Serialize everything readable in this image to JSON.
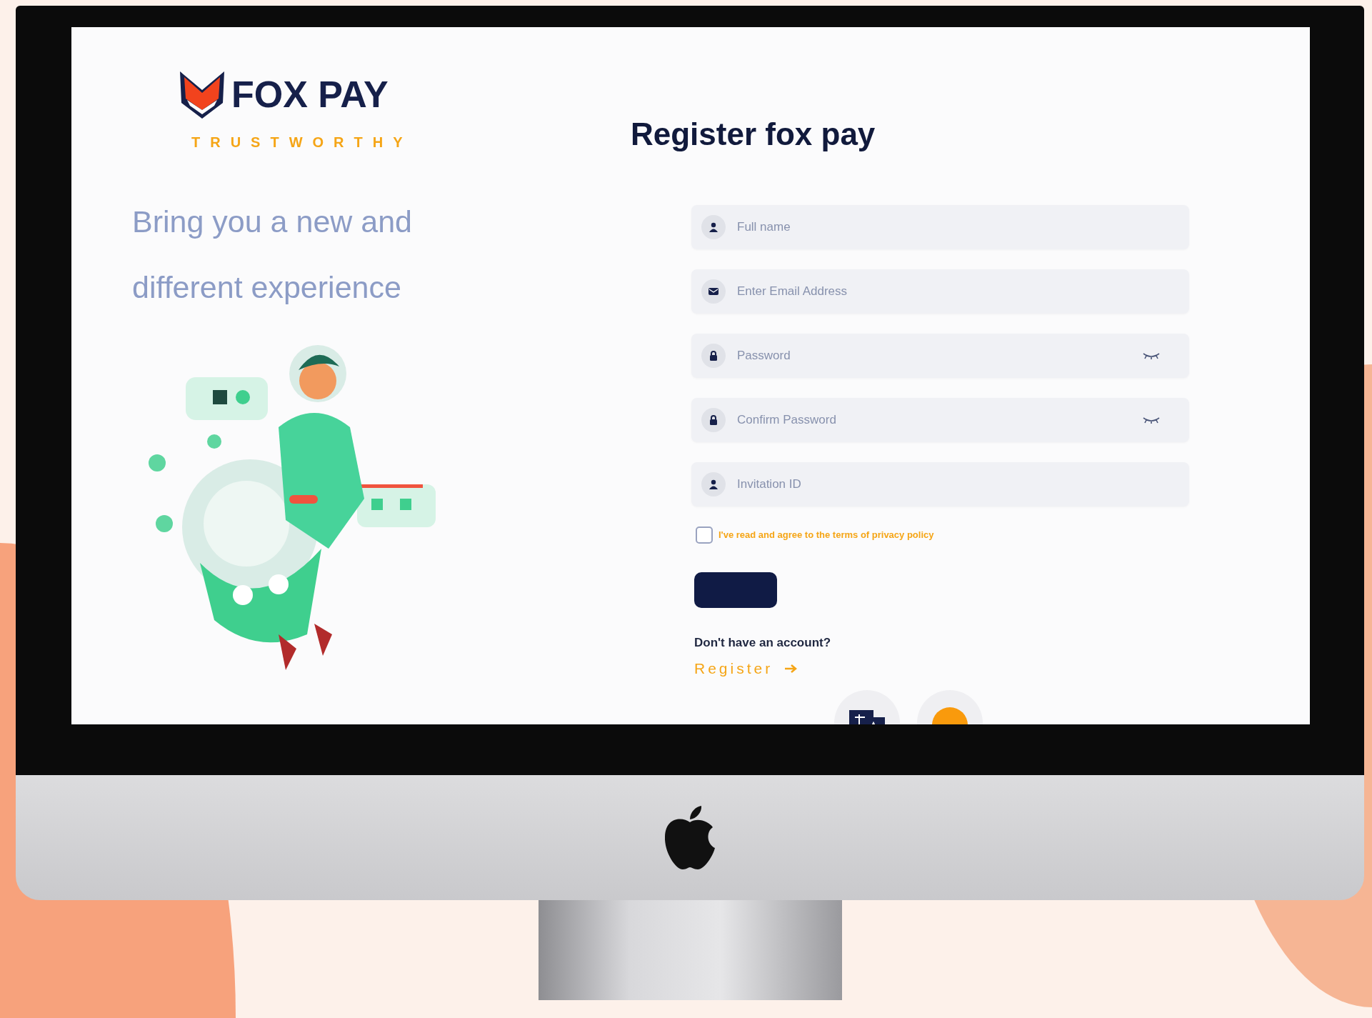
{
  "brand": {
    "name": "FOX PAY",
    "tagline": "TRUSTWORTHY"
  },
  "hero": {
    "lines": [
      "Bring you a new and",
      "different experience"
    ]
  },
  "form": {
    "title": "Register fox pay",
    "fields": [
      {
        "kind": "name",
        "placeholder": "Full name"
      },
      {
        "kind": "email",
        "placeholder": "Enter Email Address"
      },
      {
        "kind": "password",
        "placeholder": "Password"
      },
      {
        "kind": "password",
        "placeholder": "Confirm Password"
      },
      {
        "kind": "invitation",
        "placeholder": "Invitation ID"
      }
    ],
    "agreement": {
      "label": "I've read and agree to the terms of privacy policy",
      "checked": false
    },
    "prompt": "Don't have an account?",
    "register_link": "Register"
  }
}
